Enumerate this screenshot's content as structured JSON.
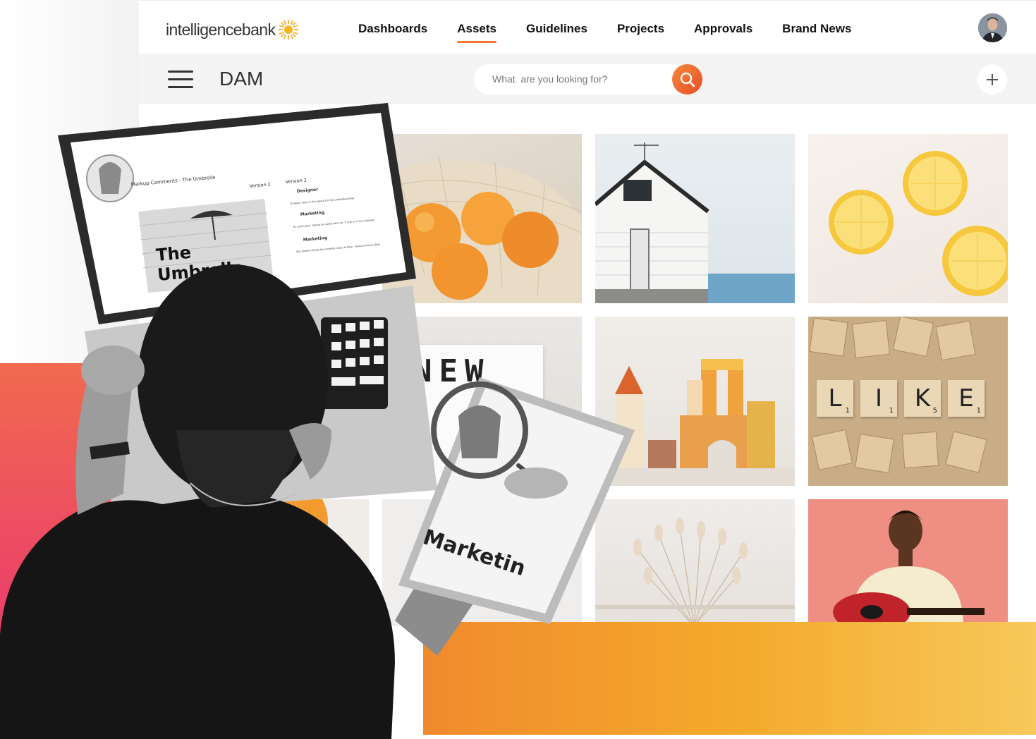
{
  "app": {
    "logo_text": "intelligencebank",
    "section_title": "DAM"
  },
  "nav": {
    "items": [
      {
        "label": "Dashboards",
        "active": false
      },
      {
        "label": "Assets",
        "active": true
      },
      {
        "label": "Guidelines",
        "active": false
      },
      {
        "label": "Projects",
        "active": false
      },
      {
        "label": "Approvals",
        "active": false
      },
      {
        "label": "Brand News",
        "active": false
      }
    ]
  },
  "search": {
    "placeholder": "What  are you looking for?"
  },
  "colors": {
    "accent": "#f37a2e",
    "search_button": "#ec5a2c",
    "gradient_pink": "#ec4468",
    "gradient_yellow": "#f7c85a"
  },
  "laptop_screen": {
    "title_line1": "The",
    "title_line2": "Umbrella",
    "header": "Markup Comments - The Umbrella",
    "version_left": "Version 2",
    "version_right": "Version 2",
    "comments": [
      {
        "author": "Designer",
        "text": "Hi team, Here is the layout for the umbrella poster."
      },
      {
        "author": "Marketing",
        "text": "Hi, Looks great. Should be capital letter for 'T' and 'U' in the umbrella!"
      },
      {
        "author": "Marketing",
        "text": "Also please change the umbrella colour to Blue - Pantone Process Blue"
      }
    ]
  },
  "tablet_screen": {
    "text": "Marketin"
  },
  "tiles": {
    "lightbox_text": "NEW",
    "like_letters": [
      {
        "letter": "L",
        "score": "1"
      },
      {
        "letter": "I",
        "score": "1"
      },
      {
        "letter": "K",
        "score": "5"
      },
      {
        "letter": "E",
        "score": "1"
      }
    ]
  },
  "icons": {
    "menu": "hamburger-icon",
    "search": "search-icon",
    "add": "plus-icon",
    "logo_mark": "sun-icon"
  }
}
